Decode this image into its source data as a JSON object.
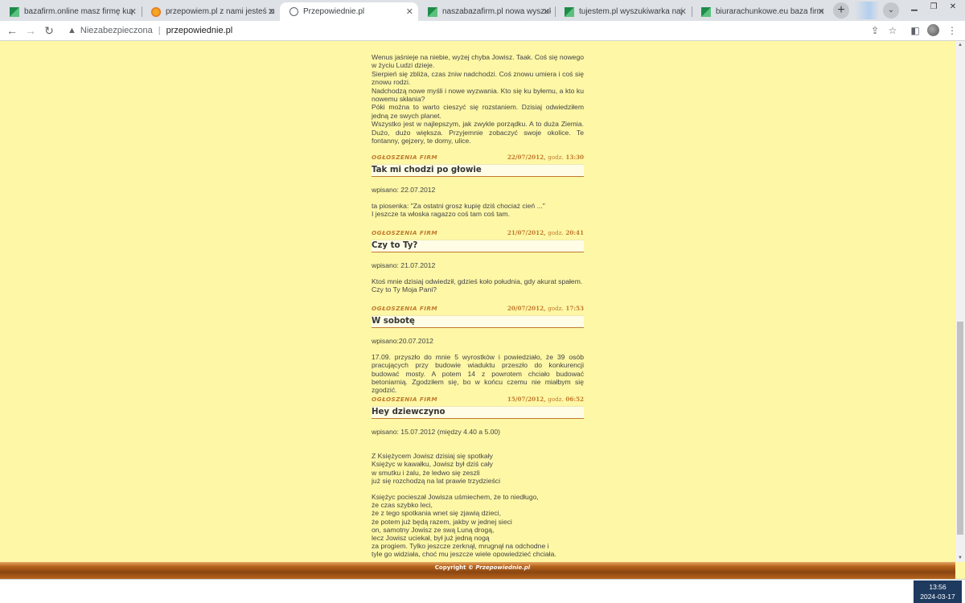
{
  "browser": {
    "tabs": [
      {
        "title": "bazafirm.online masz firmę kup w",
        "icon": "green-favicon",
        "active": false
      },
      {
        "title": "przepowiem.pl z nami jesteś zna",
        "icon": "orange-favicon",
        "active": false
      },
      {
        "title": "Przepowiednie.pl",
        "icon": "globe-icon",
        "active": true
      },
      {
        "title": "naszabazafirm.pl nowa wyszukiw",
        "icon": "green-favicon",
        "active": false
      },
      {
        "title": "tujestem.pl wyszukiwarka naj",
        "icon": "green-favicon",
        "active": false
      },
      {
        "title": "biurarachunkowe.eu baza firm ku",
        "icon": "green-favicon",
        "active": false
      }
    ],
    "new_tab": "+",
    "security_label": "Niezabezpieczona",
    "url": "przepowiednie.pl"
  },
  "intro": [
    "Wenus jaśnieje na niebie, wyżej chyba Jowisz. Taak. Coś się nowego w życiu Ludzi dzieje.",
    "Sierpień się zbliża, czas żniw nadchodzi. Coś znowu umiera i coś się znowu rodzi.",
    "Nadchodzą nowe myśli i nowe wyzwania. Kto się ku byłemu, a kto ku nowemu skłania?",
    "Póki można to warto cieszyć się rozstaniem. Dzisiaj odwiedziłem jedną ze swych planet.",
    "Wszystko jest w najlepszym, jak zwykle porządku. A to duża Ziemia. Dużo, dużo większa. Przyjemnie zobaczyć swoje okolice. Te fontanny, gejzery, te domy, ulice."
  ],
  "posts": [
    {
      "category": "OGŁOSZENIA FIRM",
      "date": "22/07/2012,",
      "godz": "godz.",
      "time": "13:30",
      "title": "Tak mi chodzi po głowie",
      "written": "wpisano: 22.07.2012",
      "lines": [
        "ta piosenka: \"Za ostatni grosz kupię dziś chociaż cień ...\"",
        "I jeszcze ta włoska ragazzo coś tam coś tam."
      ]
    },
    {
      "category": "OGŁOSZENIA FIRM",
      "date": "21/07/2012,",
      "godz": "godz.",
      "time": "20:41",
      "title": "Czy to Ty?",
      "written": "wpisano: 21.07.2012",
      "lines": [
        "Ktoś mnie dzisiaj odwiedził, gdzieś koło południa, gdy akurat spałem.",
        "Czy to Ty Moja Pani?"
      ]
    },
    {
      "category": "OGŁOSZENIA FIRM",
      "date": "20/07/2012,",
      "godz": "godz.",
      "time": "17:53",
      "title": "W sobotę",
      "written": "wpisano:20.07.2012",
      "lines": [
        "17.09. przyszło do mnie 5 wyrostków i powiedziało, że 39 osób pracujących przy budowie wiaduktu przeszło do konkurencji budować mosty. A potem 14 z powrotem chciało budować betoniarnią. Zgodziłem się, bo w końcu czemu nie miałbym się zgodzić."
      ]
    },
    {
      "category": "OGŁOSZENIA FIRM",
      "date": "15/07/2012,",
      "godz": "godz.",
      "time": "06:52",
      "title": "Hey dziewczyno",
      "written": "wpisano: 15.07.2012 (między 4.40 a 5.00)",
      "stanza1": [
        "Z Księżycem Jowisz dzisiaj się spotkały",
        "Księżyc w kawałku, Jowisz był dziś cały",
        "w smutku i żalu, że ledwo się zeszli",
        "już się rozchodzą na lat prawie trzydzieści"
      ],
      "stanza2": [
        "Księżyc pocieszał Jowisza uśmiechem, że to niedługo,",
        "że czas szybko leci,",
        "że z tego spotkania wnet się zjawią dzieci,",
        "że potem już będą razem, jakby w jednej sieci",
        "on, samotny Jowisz ze swą Luną drogą,",
        "lecz Jowisz uciekał, był już jedną nogą",
        "za progiem. Tylko jeszcze zerknął, mrugnął na odchodne i",
        "tyle go widziała, choć mu jeszcze wiele opowiedzieć chciała."
      ]
    }
  ],
  "footer": {
    "prefix": "Copyright ©",
    "brand": "Przepowiednie.pl"
  },
  "taskbar": {
    "time": "13:56",
    "date": "2024-03-17"
  },
  "colors": {
    "page_bg": "#fdf7a6",
    "accent": "#c07a2c"
  }
}
